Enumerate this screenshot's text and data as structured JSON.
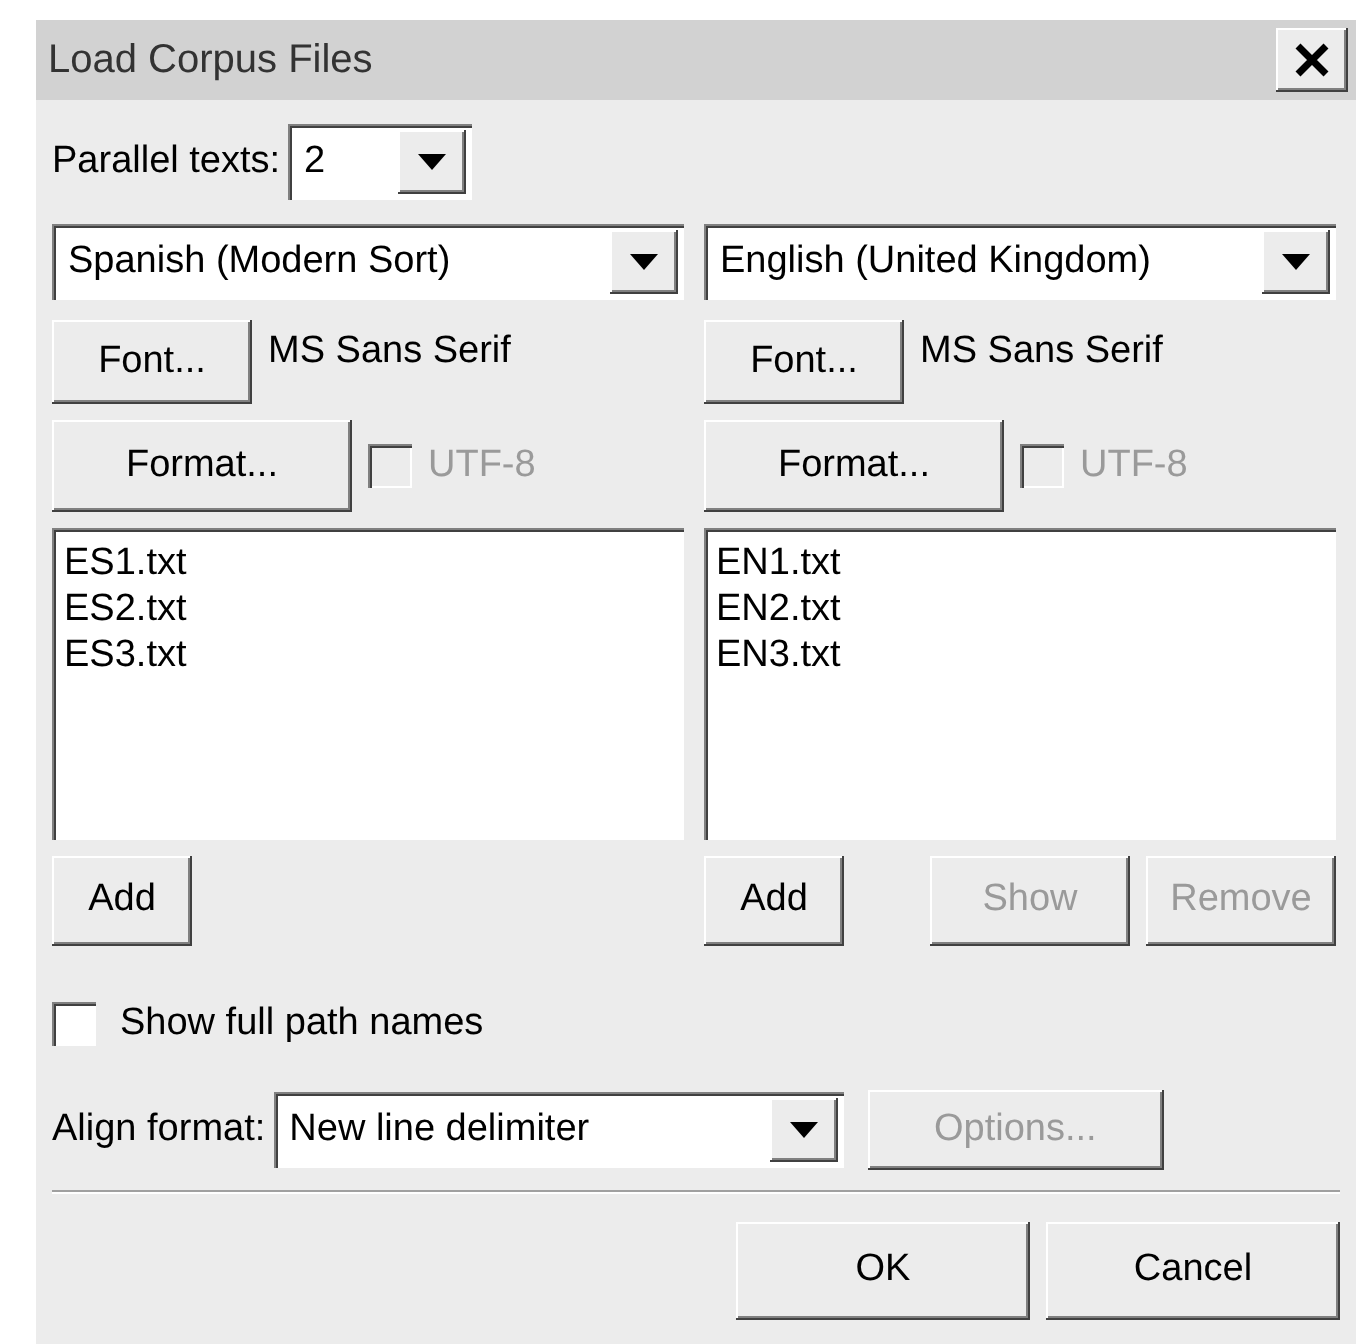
{
  "window": {
    "title": "Load Corpus Files"
  },
  "parallel_texts": {
    "label": "Parallel texts:",
    "value": "2"
  },
  "panels": [
    {
      "language": "Spanish (Modern Sort)",
      "font_button": "Font...",
      "font_name": "MS Sans Serif",
      "format_button": "Format...",
      "utf8": {
        "label": "UTF-8",
        "checked": false,
        "disabled": true
      },
      "files": [
        "ES1.txt",
        "ES2.txt",
        "ES3.txt"
      ],
      "buttons": [
        {
          "label": "Add",
          "disabled": false
        }
      ]
    },
    {
      "language": "English (United Kingdom)",
      "font_button": "Font...",
      "font_name": "MS Sans Serif",
      "format_button": "Format...",
      "utf8": {
        "label": "UTF-8",
        "checked": false,
        "disabled": true
      },
      "files": [
        "EN1.txt",
        "EN2.txt",
        "EN3.txt"
      ],
      "buttons": [
        {
          "label": "Add",
          "disabled": false
        },
        {
          "label": "Show",
          "disabled": true
        },
        {
          "label": "Remove",
          "disabled": true
        }
      ]
    }
  ],
  "show_full_path": {
    "label": "Show full path names",
    "checked": false
  },
  "align_format": {
    "label": "Align format:",
    "value": "New line delimiter",
    "options_button": {
      "label": "Options...",
      "disabled": true
    }
  },
  "buttons": [
    "OK",
    "Cancel"
  ]
}
